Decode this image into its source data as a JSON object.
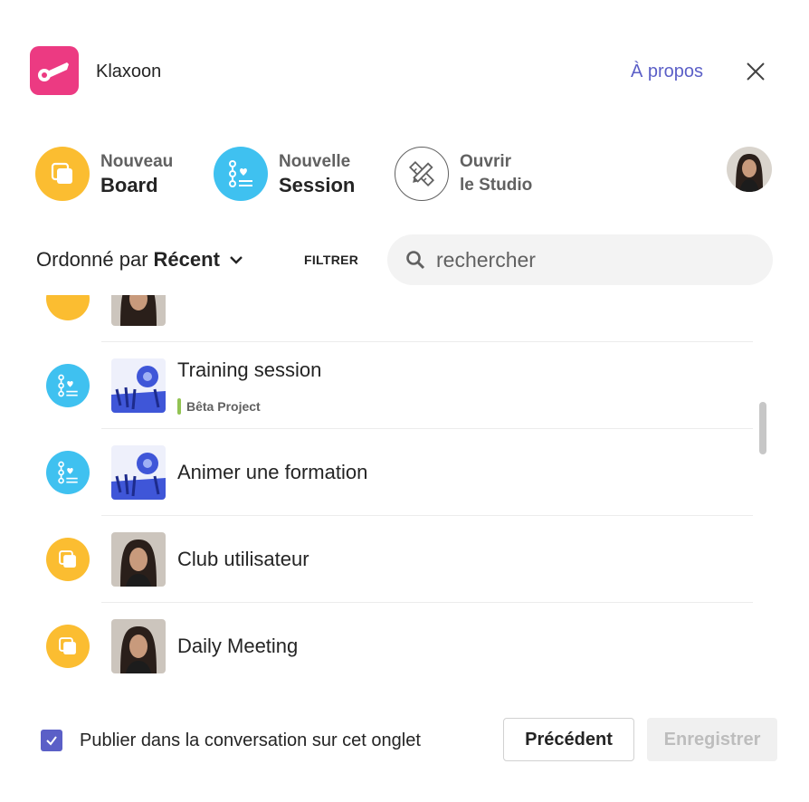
{
  "header": {
    "app_name": "Klaxoon",
    "about_link": "À propos",
    "logo_icon": "klaxoon-horn-icon",
    "close_icon": "close-icon"
  },
  "actions": [
    {
      "line1": "Nouveau",
      "line2": "Board",
      "icon": "board-icon",
      "color": "#fbbd31"
    },
    {
      "line1": "Nouvelle",
      "line2": "Session",
      "icon": "session-icon",
      "color": "#3fc1f0"
    },
    {
      "line1": "Ouvrir",
      "line2": "le Studio",
      "icon": "studio-tools-icon",
      "color": "#ffffff"
    }
  ],
  "toolbar": {
    "sort_prefix": "Ordonné par",
    "sort_value": "Récent",
    "filter_label": "FILTRER",
    "search_placeholder": "rechercher"
  },
  "items": [
    {
      "title": "",
      "type": "board",
      "tag": ""
    },
    {
      "title": "Training session",
      "type": "session",
      "tag": "Bêta Project"
    },
    {
      "title": "Animer une formation",
      "type": "session",
      "tag": ""
    },
    {
      "title": "Club utilisateur",
      "type": "board",
      "tag": ""
    },
    {
      "title": "Daily Meeting",
      "type": "board",
      "tag": ""
    }
  ],
  "footer": {
    "publish_label": "Publier dans la conversation sur cet onglet",
    "publish_checked": true,
    "prev_label": "Précédent",
    "save_label": "Enregistrer"
  },
  "colors": {
    "brand_pink": "#ec3a82",
    "board_yellow": "#fbbd31",
    "session_blue": "#3fc1f0",
    "accent_purple": "#5b5fc7",
    "tag_green": "#92c353"
  }
}
